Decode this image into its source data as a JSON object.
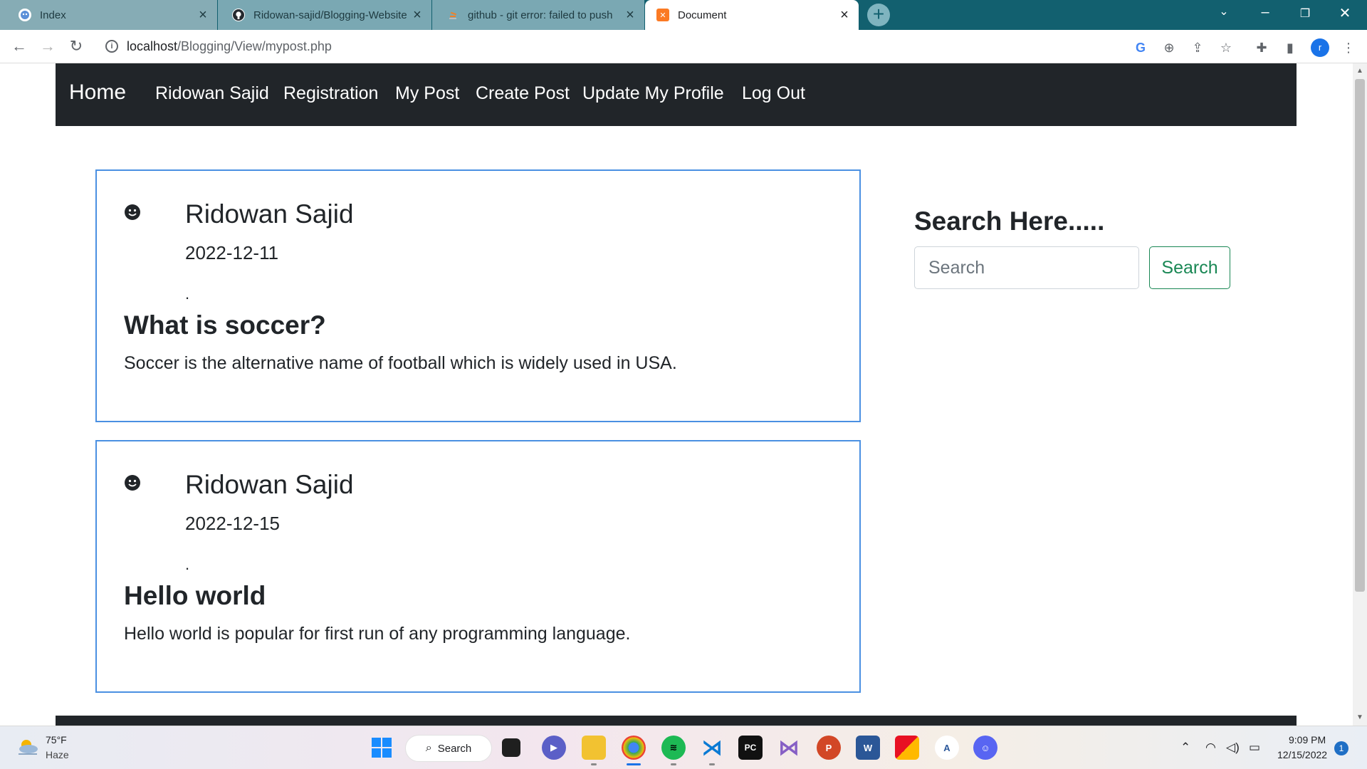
{
  "browser": {
    "tabs": [
      {
        "title": "Index",
        "active": false
      },
      {
        "title": "Ridowan-sajid/Blogging-Website",
        "active": false
      },
      {
        "title": "github - git error: failed to push",
        "active": false
      },
      {
        "title": "Document",
        "active": true
      }
    ],
    "url_host": "localhost",
    "url_path": "/Blogging/View/mypost.php",
    "profile_initial": "r"
  },
  "nav": {
    "brand": "Home",
    "items": [
      "Ridowan Sajid",
      "Registration",
      "My Post",
      "Create Post",
      "Update My Profile",
      "Log Out"
    ]
  },
  "posts": [
    {
      "author": "Ridowan Sajid",
      "date": "2022-12-11",
      "dot": ".",
      "title": "What is soccer?",
      "body": "Soccer is the alternative name of football which is widely used in USA."
    },
    {
      "author": "Ridowan Sajid",
      "date": "2022-12-15",
      "dot": ".",
      "title": "Hello world",
      "body": "Hello world is popular for first run of any programming language."
    }
  ],
  "search": {
    "heading": "Search Here.....",
    "placeholder": "Search",
    "button": "Search"
  },
  "taskbar": {
    "weather_temp": "75°F",
    "weather_condition": "Haze",
    "search_label": "Search",
    "time": "9:09 PM",
    "date": "12/15/2022",
    "notifications": "1"
  },
  "colors": {
    "tabstrip": "#12606f",
    "navbar": "#212529",
    "card_border": "#4a90e2",
    "search_button": "#198754"
  }
}
